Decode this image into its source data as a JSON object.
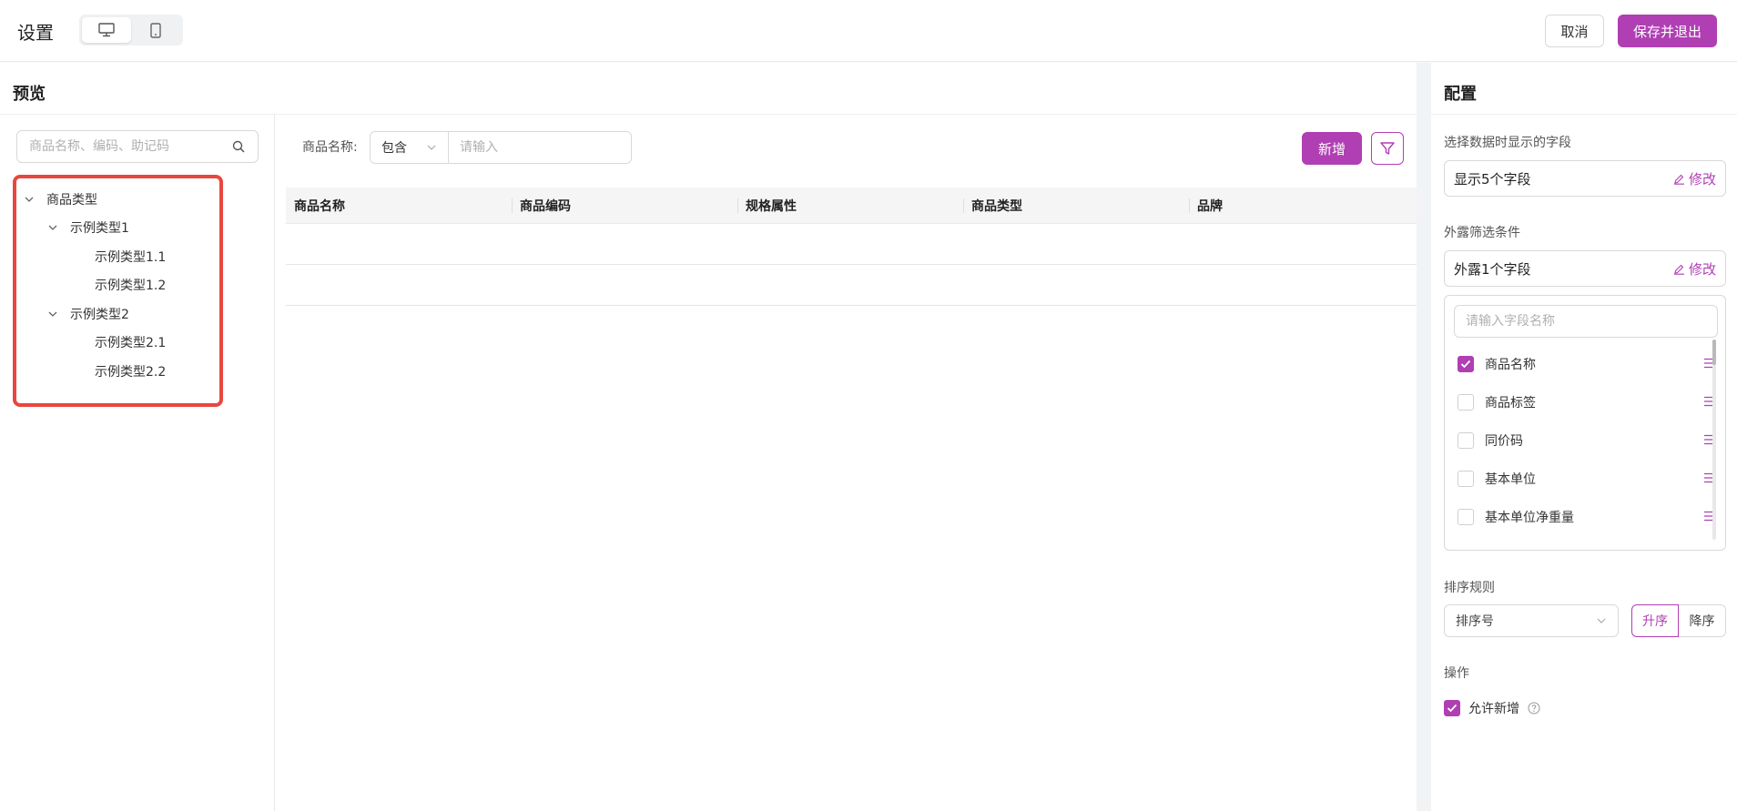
{
  "header": {
    "title": "设置",
    "cancel_label": "取消",
    "save_label": "保存并退出"
  },
  "preview": {
    "title": "预览",
    "tree_search_placeholder": "商品名称、编码、助记码",
    "tree": {
      "root": "商品类型",
      "group1": "示例类型1",
      "group1_child1": "示例类型1.1",
      "group1_child2": "示例类型1.2",
      "group2": "示例类型2",
      "group2_child1": "示例类型2.1",
      "group2_child2": "示例类型2.2"
    },
    "filter": {
      "label": "商品名称:",
      "operator": "包含",
      "placeholder": "请输入"
    },
    "add_label": "新增",
    "columns": [
      "商品名称",
      "商品编码",
      "规格属性",
      "商品类型",
      "品牌"
    ]
  },
  "config": {
    "title": "配置",
    "display_fields_label": "选择数据时显示的字段",
    "display_fields_value": "显示5个字段",
    "exposed_filter_label": "外露筛选条件",
    "exposed_filter_value": "外露1个字段",
    "edit_label": "修改",
    "field_search_placeholder": "请输入字段名称",
    "fields": [
      {
        "label": "商品名称",
        "checked": true
      },
      {
        "label": "商品标签",
        "checked": false
      },
      {
        "label": "同价码",
        "checked": false
      },
      {
        "label": "基本单位",
        "checked": false
      },
      {
        "label": "基本单位净重量",
        "checked": false
      }
    ],
    "sort_label": "排序规则",
    "sort_field": "排序号",
    "asc_label": "升序",
    "desc_label": "降序",
    "operations_label": "操作",
    "allow_add_label": "允许新增",
    "allow_add_checked": true
  },
  "colors": {
    "accent": "#b03fb3",
    "highlight": "#e8473f"
  }
}
